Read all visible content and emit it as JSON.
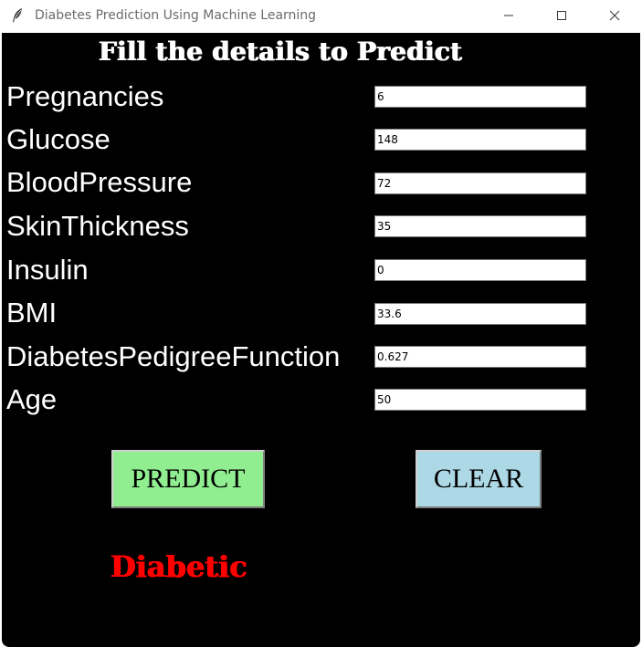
{
  "window": {
    "title": "Diabetes Prediction Using Machine Learning"
  },
  "form": {
    "heading": "Fill the details to Predict",
    "fields": [
      {
        "label": "Pregnancies",
        "value": "6"
      },
      {
        "label": "Glucose",
        "value": "148"
      },
      {
        "label": "BloodPressure",
        "value": "72"
      },
      {
        "label": "SkinThickness",
        "value": "35"
      },
      {
        "label": "Insulin",
        "value": "0"
      },
      {
        "label": "BMI",
        "value": "33.6"
      },
      {
        "label": "DiabetesPedigreeFunction",
        "value": "0.627"
      },
      {
        "label": "Age",
        "value": "50"
      }
    ]
  },
  "buttons": {
    "predict_label": "PREDICT",
    "clear_label": "CLEAR"
  },
  "result": {
    "text": "Diabetic"
  },
  "colors": {
    "background": "#000000",
    "predict_button": "#90ee90",
    "clear_button": "#add8e6",
    "result_text": "#ff0000",
    "label_text": "#ffffff"
  },
  "icons": {
    "app": "feather-icon",
    "minimize": "minimize-icon",
    "maximize": "maximize-icon",
    "close": "close-icon"
  }
}
